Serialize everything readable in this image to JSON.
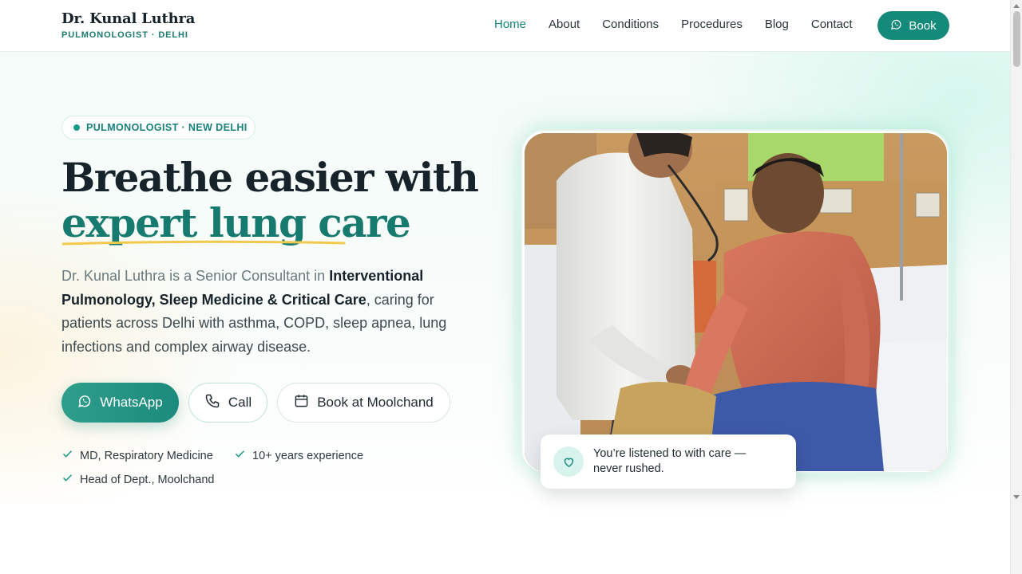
{
  "brand": {
    "name": "Dr. Kunal Luthra",
    "subtitle": "PULMONOLOGIST · DELHI"
  },
  "nav": {
    "items": [
      {
        "label": "Home",
        "active": true
      },
      {
        "label": "About"
      },
      {
        "label": "Conditions"
      },
      {
        "label": "Procedures"
      },
      {
        "label": "Blog"
      },
      {
        "label": "Contact"
      }
    ],
    "book_label": "Book"
  },
  "hero": {
    "badge": "PULMONOLOGIST · NEW DELHI",
    "headline_line1": "Breathe easier with",
    "headline_accent": "expert lung care",
    "lead": {
      "part1": "Dr. Kunal Luthra is a Senior Consultant in ",
      "bold1": "Interventional Pulmonology, Sleep Medicine & Critical Care",
      "part2": ", caring for patients across Delhi with asthma, COPD, sleep apnea, lung infections and complex airway disease."
    },
    "buttons": {
      "whatsapp": "WhatsApp",
      "call": "Call",
      "moolchand": "Book at Moolchand"
    },
    "credentials": [
      "MD, Respiratory Medicine",
      "10+ years experience",
      "Head of Dept., Moolchand"
    ],
    "quote": "You’re listened to with care — never rushed."
  },
  "colors": {
    "primary": "#148a7b",
    "accent_text": "#167a6f",
    "underline": "#f2c94c"
  },
  "icons": {
    "book_button": "whatsapp-icon",
    "whatsapp_button": "whatsapp-icon",
    "call_button": "phone-icon",
    "moolchand_button": "calendar-icon",
    "credential": "check-icon",
    "quote": "heart-icon"
  }
}
